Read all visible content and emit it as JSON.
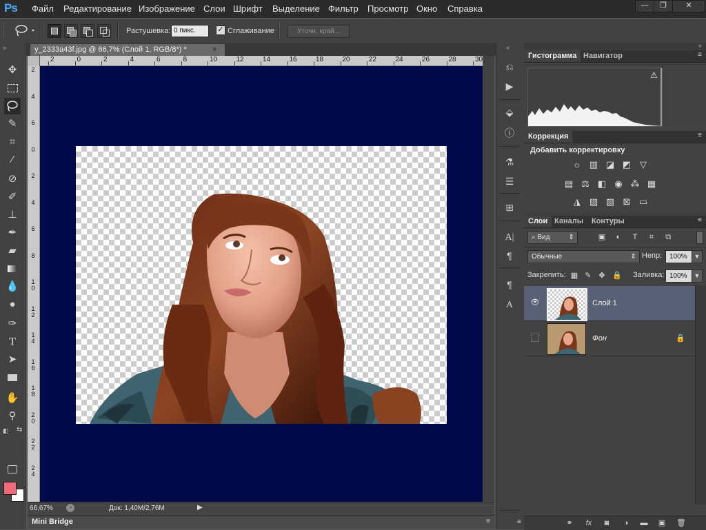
{
  "app": {
    "logo": "Ps",
    "menu": [
      "Файл",
      "Редактирование",
      "Изображение",
      "Слои",
      "Шрифт",
      "Выделение",
      "Фильтр",
      "Просмотр",
      "Окно",
      "Справка"
    ],
    "window_controls": {
      "minimize": "—",
      "restore": "❐",
      "close": "✕"
    }
  },
  "options_bar": {
    "feather_label": "Растушевка:",
    "feather_value": "0 пикс.",
    "smoothing_label": "Сглаживание",
    "smoothing_checked": true,
    "refine_edge_label": "Уточн. край..."
  },
  "toolbar": {
    "active_tool": "lasso-tool",
    "foreground_color": "#f06a7a",
    "background_color": "#ffffff"
  },
  "document": {
    "tab_title": "y_2333a43f.jpg @ 66,7% (Слой 1, RGB/8*) *",
    "tab_close": "×",
    "ruler_top": [
      "2",
      "0",
      "2",
      "4",
      "6",
      "8",
      "10",
      "12",
      "14",
      "16",
      "18",
      "20",
      "22",
      "24",
      "26",
      "28",
      "30"
    ],
    "ruler_left": [
      "2",
      "4",
      "6",
      "0",
      "2",
      "4",
      "6",
      "8",
      "1 0",
      "1 2",
      "1 4",
      "1 6",
      "1 8",
      "2 0",
      "2 2",
      "2 4"
    ],
    "canvas_bg": "#010a4b",
    "zoom": "66,67%",
    "doc_size": "Док: 1,40M/2,76M"
  },
  "mini_bridge": {
    "label": "Mini Bridge"
  },
  "panels": {
    "top_tabs": [
      "Гистограмма",
      "Навигатор"
    ],
    "histogram_warning": "⚠",
    "correction_tab": "Коррекция",
    "correction_title": "Добавить корректировку",
    "layers_tabs": [
      "Слои",
      "Каналы",
      "Контуры"
    ],
    "filter_kind": "Вид",
    "blend_mode": "Обычные",
    "opacity_label": "Непр:",
    "opacity_value": "100%",
    "lock_label": "Закрепить:",
    "fill_label": "Заливка:",
    "fill_value": "100%",
    "layers": [
      {
        "name": "Слой 1",
        "visible": true,
        "selected": true,
        "locked": false
      },
      {
        "name": "Фон",
        "visible": false,
        "selected": false,
        "locked": true
      }
    ]
  }
}
